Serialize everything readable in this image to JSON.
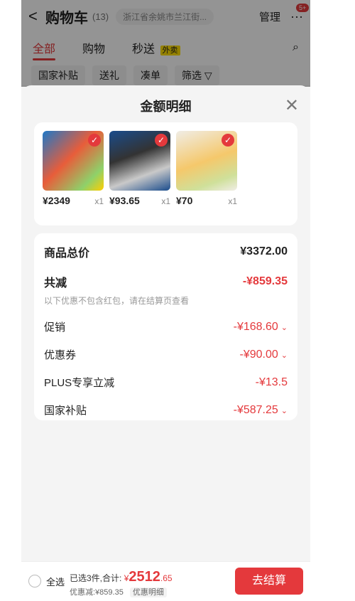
{
  "header": {
    "back": "<",
    "title": "购物车",
    "count": "(13)",
    "location": "浙江省余姚市兰江街...",
    "manage": "管理",
    "more": "···",
    "badge": "5+"
  },
  "tabs": {
    "all": "全部",
    "shop": "购物",
    "flash": "秒送",
    "takeout": "外卖"
  },
  "chips": [
    "国家补贴",
    "送礼",
    "凑单",
    "筛选"
  ],
  "sheet": {
    "title": "金额明细",
    "close": "✕"
  },
  "products": [
    {
      "price": "¥2349",
      "qty": "x1"
    },
    {
      "price": "¥93.65",
      "qty": "x1"
    },
    {
      "price": "¥70",
      "qty": "x1"
    }
  ],
  "summary": {
    "goods_total_label": "商品总价",
    "goods_total_value": "¥3372.00",
    "reduce_label": "共减",
    "reduce_value": "-¥859.35",
    "note": "以下优惠不包含红包，请在结算页查看",
    "promo_label": "促销",
    "promo_value": "-¥168.60",
    "coupon_label": "优惠券",
    "coupon_value": "-¥90.00",
    "plus_label": "PLUS专享立减",
    "plus_value": "-¥13.5",
    "subsidy_label": "国家补贴",
    "subsidy_value": "-¥587.25"
  },
  "bottom": {
    "all": "全选",
    "selected": "已选3件,合计:",
    "currency": "¥",
    "total_int": "2512",
    "total_dec": ".65",
    "discount_text": "优惠减:¥859.35",
    "discount_btn": "优惠明细",
    "checkout": "去结算"
  },
  "colors": {
    "accent": "#e4393c"
  }
}
